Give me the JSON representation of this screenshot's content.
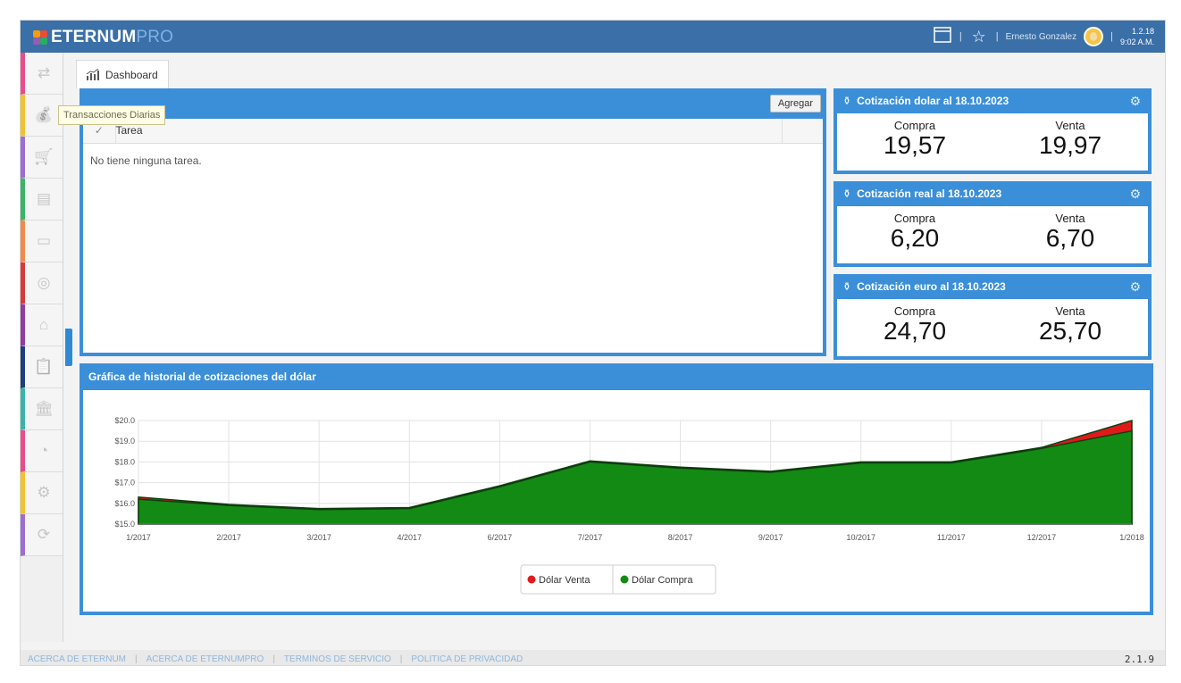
{
  "header": {
    "brand": "ETERNUM",
    "brand_suffix": "PRO",
    "user_name": "Ernesto Gonzalez",
    "app_version": "1.2.18",
    "time": "9:02 A.M."
  },
  "tab": {
    "label": "Dashboard"
  },
  "tooltip": "Transacciones Diarias",
  "tasks": {
    "add_button": "Agregar",
    "column_check": "✓",
    "column_task": "Tarea",
    "empty": "No tiene ninguna tarea."
  },
  "quotes": [
    {
      "title": "Cotización dolar al 18.10.2023",
      "buy_label": "Compra",
      "buy": "19,57",
      "sell_label": "Venta",
      "sell": "19,97"
    },
    {
      "title": "Cotización real  al 18.10.2023",
      "buy_label": "Compra",
      "buy": "6,20",
      "sell_label": "Venta",
      "sell": "6,70"
    },
    {
      "title": "Cotización euro  al 18.10.2023",
      "buy_label": "Compra",
      "buy": "24,70",
      "sell_label": "Venta",
      "sell": "25,70"
    }
  ],
  "chart": {
    "title": "Gráfica de historial de cotizaciones del dólar"
  },
  "chart_data": {
    "type": "area",
    "x": [
      "1/2017",
      "2/2017",
      "3/2017",
      "4/2017",
      "6/2017",
      "7/2017",
      "8/2017",
      "9/2017",
      "10/2017",
      "11/2017",
      "12/2017",
      "1/2018"
    ],
    "yticks": [
      "$20.0",
      "$19.0",
      "$18.0",
      "$17.0",
      "$16.0",
      "$15.0"
    ],
    "ylim": [
      15,
      20
    ],
    "series": [
      {
        "name": "Dólar Venta",
        "color": "#e01a1a",
        "values": [
          16.3,
          15.95,
          15.75,
          15.8,
          16.85,
          18.05,
          17.75,
          17.55,
          18.0,
          18.0,
          18.7,
          20.0
        ]
      },
      {
        "name": "Dólar Compra",
        "color": "#138a13",
        "values": [
          16.2,
          15.9,
          15.7,
          15.75,
          16.8,
          18.0,
          17.7,
          17.5,
          17.95,
          17.95,
          18.65,
          19.5
        ]
      }
    ],
    "legend": "bottom-center",
    "grid": true
  },
  "sidebar_colors": [
    "#e84c8b",
    "#f2c12e",
    "#9b6fcf",
    "#3bb36b",
    "#f08a4b",
    "#d63a3a",
    "#8e3f9e",
    "#1f3d7a",
    "#3bb3a7",
    "#e84c8b",
    "#f2c12e",
    "#9b6fcf"
  ],
  "sidebar_icons": [
    "transfer-icon",
    "money-bag-icon",
    "cart-icon",
    "cash-register-icon",
    "cash-icon",
    "coins-icon",
    "factory-icon",
    "clipboard-icon",
    "bank-icon",
    "pie-chart-icon",
    "settings-icon",
    "sync-icon"
  ],
  "footer": {
    "links": [
      "ACERCA DE ETERNUM",
      "ACERCA DE ETERNUMPRO",
      "TERMINOS DE SERVICIO",
      "POLITICA DE PRIVACIDAD"
    ],
    "version": "2.1.9"
  }
}
